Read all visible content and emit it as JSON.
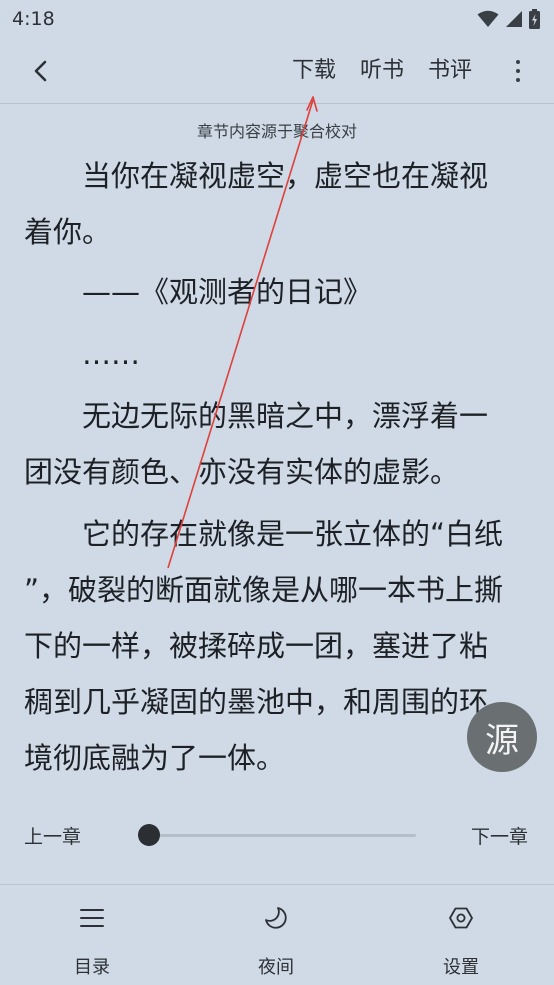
{
  "status_bar": {
    "time": "4:18"
  },
  "toolbar": {
    "download": "下载",
    "listen": "听书",
    "review": "书评"
  },
  "reader": {
    "source_note": "章节内容源于聚合校对",
    "lines": [
      "当你在凝视虚空，虚空也在凝视",
      "着你。",
      "——《观测者的日记》",
      "……",
      "无边无际的黑暗之中，漂浮着一",
      "团没有颜色、亦没有实体的虚影。",
      "它的存在就像是一张立体的“白纸",
      "”，破裂的断面就像是从哪一本书上撕",
      "下的一样，被揉碎成一团，塞进了粘",
      "稠到几乎凝固的墨池中，和周围的环",
      "境彻底融为了一体。"
    ]
  },
  "fab": {
    "source_label": "源"
  },
  "chapter_nav": {
    "prev": "上一章",
    "next": "下一章",
    "progress": 0.04
  },
  "bottom_nav": {
    "toc": "目录",
    "night": "夜间",
    "settings": "设置"
  },
  "colors": {
    "background": "#cfdae6",
    "annotation": "#e0403a",
    "fab": "#6a6f72"
  },
  "icons": [
    "back-arrow-icon",
    "more-vert-icon",
    "menu-list-icon",
    "moon-icon",
    "settings-hexagon-icon",
    "wifi-icon",
    "signal-icon",
    "battery-icon"
  ]
}
